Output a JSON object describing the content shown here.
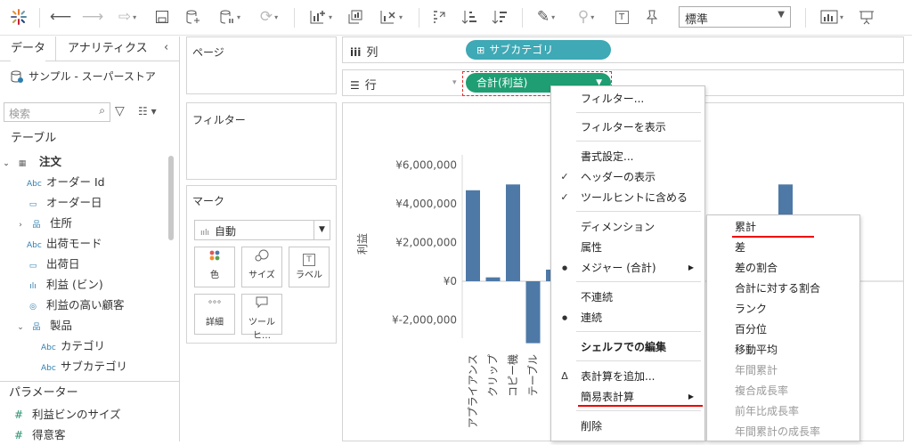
{
  "toolbar": {
    "mark_label_glyph": "T",
    "font_size_select": "標準"
  },
  "left_pane": {
    "tabs": [
      "データ",
      "アナリティクス"
    ],
    "datasource": "サンプル - スーパーストア",
    "search_placeholder": "検索",
    "tables_header": "テーブル",
    "fields": [
      {
        "label": "注文",
        "icon": "table-icon",
        "kind": "table"
      },
      {
        "label": "オーダー Id",
        "icon": "Abc",
        "kind": "dim"
      },
      {
        "label": "オーダー日",
        "icon": "calendar-icon",
        "kind": "dim"
      },
      {
        "label": "住所",
        "icon": "hierarchy-icon",
        "kind": "folder"
      },
      {
        "label": "出荷モード",
        "icon": "Abc",
        "kind": "dim"
      },
      {
        "label": "出荷日",
        "icon": "calendar-icon",
        "kind": "dim"
      },
      {
        "label": "利益 (ビン)",
        "icon": "bin-icon",
        "kind": "dim"
      },
      {
        "label": "利益の高い顧客",
        "icon": "set-icon",
        "kind": "dim"
      },
      {
        "label": "製品",
        "icon": "hierarchy-icon",
        "kind": "folder"
      },
      {
        "label": "カテゴリ",
        "icon": "Abc",
        "kind": "dim"
      },
      {
        "label": "サブカテゴリ",
        "icon": "Abc",
        "kind": "dim"
      }
    ],
    "parameters_header": "パラメーター",
    "parameters": [
      {
        "label": "利益ビンのサイズ",
        "icon": "#"
      },
      {
        "label": "得意客",
        "icon": "#"
      }
    ]
  },
  "cards": {
    "pages": "ページ",
    "filters": "フィルター",
    "marks": "マーク",
    "mark_type": "自動",
    "mark_buttons": [
      "色",
      "サイズ",
      "ラベル",
      "詳細",
      "ツールヒ…"
    ]
  },
  "shelves": {
    "columns_label": "列",
    "rows_label": "行",
    "columns_pill": "サブカテゴリ",
    "rows_pill": "合計(利益)"
  },
  "view": {
    "y_axis_title": "利益",
    "y_ticks": [
      "¥6,000,000",
      "¥4,000,000",
      "¥2,000,000",
      "¥0",
      "¥-2,000,000"
    ],
    "x_labels": [
      "アプライアンス",
      "クリップ",
      "コピー機",
      "テーブル"
    ]
  },
  "chart_data": {
    "type": "bar",
    "categories": [
      "アプライアンス",
      "クリップ",
      "コピー機",
      "テーブル",
      "",
      "",
      "",
      ""
    ],
    "values": [
      4700000,
      200000,
      5000000,
      -3200000,
      600000,
      0,
      0,
      5000000
    ],
    "ylabel": "利益",
    "ylim": [
      -3500000,
      7000000
    ],
    "bar_color": "#4e79a7"
  },
  "context_menu": {
    "items": [
      {
        "label": "フィルター...",
        "mark": ""
      },
      {
        "label": "フィルターを表示",
        "mark": ""
      },
      {
        "label": "書式設定...",
        "mark": ""
      },
      {
        "label": "ヘッダーの表示",
        "mark": "✓"
      },
      {
        "label": "ツールヒントに含める",
        "mark": "✓"
      },
      {
        "label": "ディメンション",
        "mark": ""
      },
      {
        "label": "属性",
        "mark": ""
      },
      {
        "label": "メジャー (合計)",
        "mark": "●"
      },
      {
        "label": "不連続",
        "mark": ""
      },
      {
        "label": "連続",
        "mark": "●"
      },
      {
        "label": "シェルフでの編集",
        "mark": ""
      },
      {
        "label": "表計算を追加...",
        "mark": "Δ"
      },
      {
        "label": "簡易表計算",
        "mark": ""
      },
      {
        "label": "削除",
        "mark": ""
      }
    ]
  },
  "submenu": {
    "items": [
      "累計",
      "差",
      "差の割合",
      "合計に対する割合",
      "ランク",
      "百分位",
      "移動平均",
      "年間累計",
      "複合成長率",
      "前年比成長率",
      "年間累計の成長率"
    ]
  },
  "colors": {
    "pill_green": "#1f9e74",
    "pill_teal": "#3fa9b5",
    "bar": "#4e79a7",
    "highlight_red": "#e00000"
  }
}
